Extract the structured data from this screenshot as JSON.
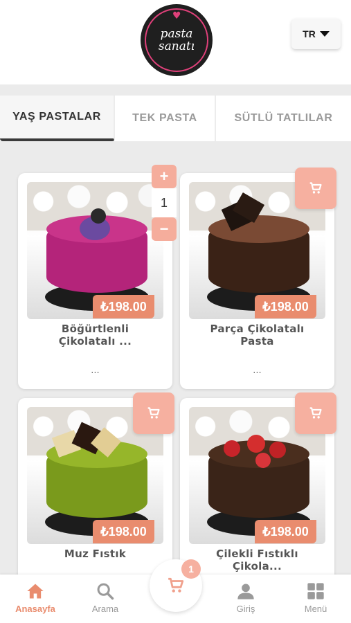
{
  "brand": {
    "logo_line1": "pasta",
    "logo_line2": "sanatı",
    "accent_color": "#e98c6e",
    "logo_heart_color": "#e0407a"
  },
  "language": {
    "selected": "TR",
    "icon": "caret-down-icon"
  },
  "tabs": [
    {
      "label": "YAŞ PASTALAR",
      "active": true
    },
    {
      "label": "TEK PASTA",
      "active": false
    },
    {
      "label": "SÜTLÜ TATLILAR",
      "active": false
    }
  ],
  "products": [
    {
      "name_line1": "Böğürtlenli",
      "name_line2": "Çikolatalı ...",
      "price": "₺198.00",
      "description": "...",
      "quantity": "1",
      "stepper": {
        "plus": "+",
        "minus": "−"
      }
    },
    {
      "name_line1": "Parça Çikolatalı",
      "name_line2": "Pasta",
      "price": "₺198.00",
      "description": "...",
      "cart_icon": "cart-icon"
    },
    {
      "name_line1": "Muz Fıstık",
      "name_line2": "",
      "price": "₺198.00",
      "cart_icon": "cart-icon"
    },
    {
      "name_line1": "Çilekli Fıstıklı",
      "name_line2": "Çikola...",
      "price": "₺198.00",
      "cart_icon": "cart-icon"
    }
  ],
  "bottom_nav": {
    "items": [
      {
        "label": "Anasayfa",
        "icon": "home-icon",
        "active": true
      },
      {
        "label": "Arama",
        "icon": "search-icon",
        "active": false
      },
      {
        "label": "Giriş",
        "icon": "user-icon",
        "active": false
      },
      {
        "label": "Menü",
        "icon": "grid-icon",
        "active": false
      }
    ],
    "cart": {
      "icon": "cart-icon",
      "badge_count": "1"
    }
  }
}
